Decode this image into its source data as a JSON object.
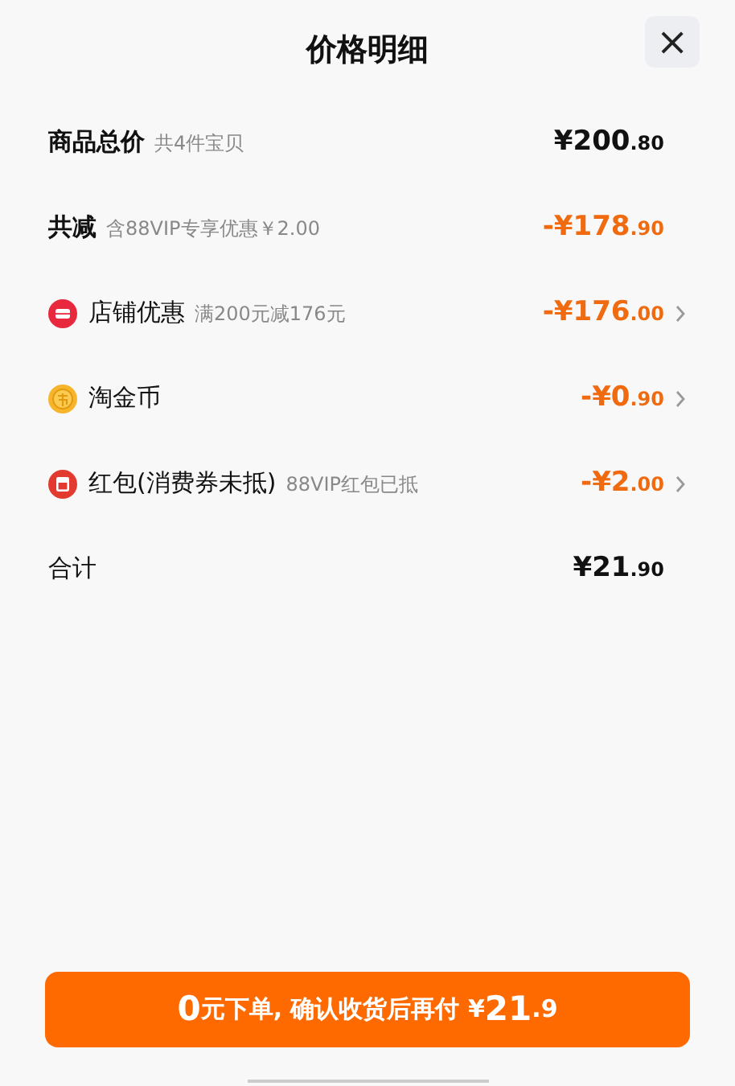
{
  "title": "价格明细",
  "close": "×",
  "rows": [
    {
      "kind": "total",
      "label": "商品总价",
      "note": "共4件宝贝",
      "amount": "¥200.80"
    },
    {
      "kind": "reduction",
      "label": "共减",
      "note": "含88VIP专享优惠￥2.00",
      "amount": "-¥178.90"
    },
    {
      "kind": "shop",
      "label": "店铺优惠",
      "note": "满200元减176元",
      "amount": "-¥176.00"
    },
    {
      "kind": "coin",
      "label": "淘金币",
      "amount": "-¥0.90"
    },
    {
      "kind": "packet",
      "label": "红包(消费券未抵)",
      "note": "88VIP红包已抵",
      "amount": "-¥2.00"
    },
    {
      "kind": "sum",
      "label": "合计",
      "amount": "¥21.90"
    }
  ],
  "button": [
    {
      "text": "0",
      "emphasis": true
    },
    {
      "text": "元下单, 确认收货后再付 ¥",
      "emphasis": false
    },
    {
      "text": "21",
      "emphasis": true
    },
    {
      "text": ".9",
      "emphasis": false
    }
  ]
}
